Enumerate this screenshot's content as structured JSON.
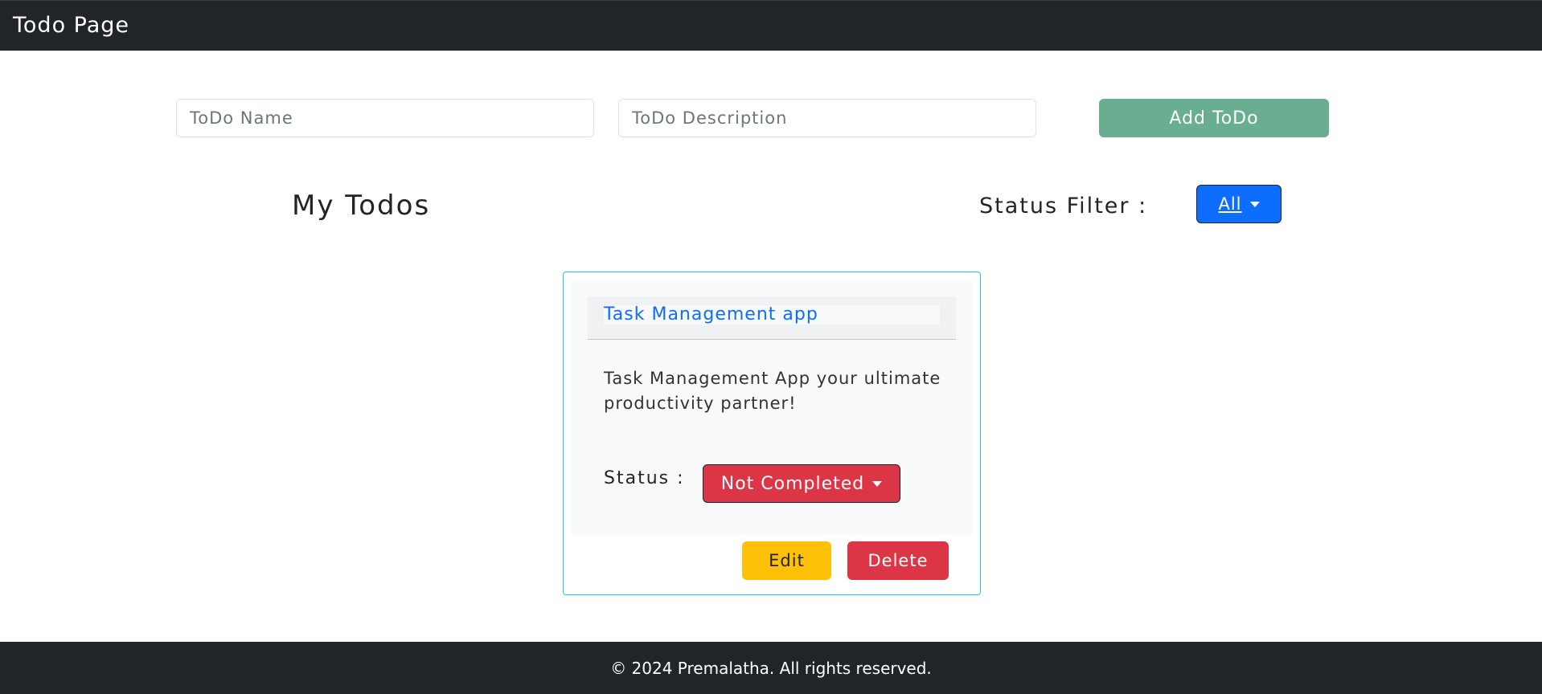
{
  "navbar": {
    "title": "Todo Page"
  },
  "form": {
    "name_placeholder": "ToDo Name",
    "description_placeholder": "ToDo Description",
    "add_button": "Add ToDo"
  },
  "todos_section": {
    "heading": "My Todos",
    "filter_label": "Status Filter :",
    "filter_value": "All"
  },
  "todos": [
    {
      "title": "Task Management app",
      "description": "Task Management App your ultimate productivity partner!",
      "status_label": "Status :",
      "status_value": "Not Completed",
      "edit_label": "Edit",
      "delete_label": "Delete"
    }
  ],
  "footer": {
    "text": "© 2024 Premalatha. All rights reserved."
  },
  "colors": {
    "navbar_bg": "#212529",
    "add_button_bg": "#6aae92",
    "filter_button_bg": "#0d6efd",
    "status_button_bg": "#dc3545",
    "edit_button_bg": "#ffc107",
    "delete_button_bg": "#dc3545",
    "card_border": "#1fc8e0"
  },
  "icons": {
    "dropdown": "caret-down-icon"
  }
}
